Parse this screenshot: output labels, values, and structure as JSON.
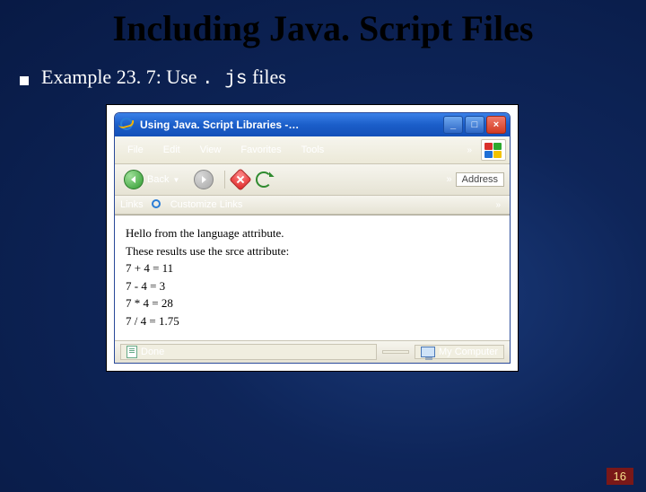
{
  "slide": {
    "title": "Including Java. Script Files",
    "bullet_prefix": "Example 23. 7: Use",
    "bullet_mono": ". js",
    "bullet_suffix": " files",
    "page_number": "16"
  },
  "ie": {
    "title": "Using Java. Script Libraries -…",
    "menu": {
      "file": "File",
      "edit": "Edit",
      "view": "View",
      "favorites": "Favorites",
      "tools": "Tools",
      "overflow": "»"
    },
    "toolbar": {
      "back_label": "Back",
      "overflow": "»",
      "address_label": "Address"
    },
    "linksbar": {
      "links_label": "Links",
      "customize_label": "Customize Links",
      "overflow": "»"
    },
    "content": {
      "line1": "Hello from the language attribute.",
      "line2": "These results use the srce attribute:",
      "line3": "7 + 4 = 11",
      "line4": "7 - 4 = 3",
      "line5": "7 * 4 = 28",
      "line6": "7 / 4 = 1.75"
    },
    "status": {
      "done": "Done",
      "zone": "My Computer"
    }
  }
}
